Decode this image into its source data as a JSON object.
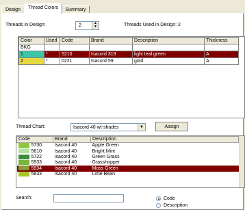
{
  "tabs": [
    "Design",
    "Thread Colors",
    "Summary"
  ],
  "threads_in_design_label": "Threads in Design:",
  "threads_in_design_value": "2",
  "threads_used_label": "Threads Used in Design: 2",
  "table": {
    "headers": [
      "Color",
      "Used",
      "Code",
      "Brand",
      "Description",
      "Thickness"
    ],
    "rows": [
      {
        "color_label": "BKG",
        "color": "#ffffff",
        "used": "",
        "code": "",
        "brand": "",
        "description": "",
        "thickness": ""
      },
      {
        "color_label": "1",
        "color": "#3cc8a8",
        "used": "*",
        "code": "5210",
        "brand": "Isacord 319",
        "description": "light teal green",
        "thickness": "A",
        "selected": true
      },
      {
        "color_label": "2",
        "color": "#e8d840",
        "used": "*",
        "code": "0221",
        "brand": "Isacord 59",
        "description": "gold",
        "thickness": "A"
      }
    ]
  },
  "thread_chart_label": "Thread Chart:",
  "thread_chart_value": "Isacord 40 wt-shades",
  "assign_label": "Assign",
  "chart_table": {
    "headers": [
      "Code",
      "Brand",
      "Description"
    ],
    "rows": [
      {
        "code": "5730",
        "brand": "Isacord 40",
        "description": "Apple Green",
        "color": "#8cc63c"
      },
      {
        "code": "5610",
        "brand": "Isacord 40",
        "description": "Bright Mint",
        "color": "#b6e0a0"
      },
      {
        "code": "5722",
        "brand": "Isacord 40",
        "description": "Green Grass",
        "color": "#3c8c3c"
      },
      {
        "code": "5933",
        "brand": "Isacord 40",
        "description": "Grasshopper",
        "color": "#7cb442"
      },
      {
        "code": "5934",
        "brand": "Isacord 40",
        "description": "Moss Green",
        "color": "#8c9a3a",
        "selected": true
      },
      {
        "code": "5833",
        "brand": "Isacord 40",
        "description": "Lime Bean",
        "color": "#a8c828"
      }
    ]
  },
  "search_label": "Search:",
  "search_value": "",
  "radio_code": "Code",
  "radio_description": "Description"
}
